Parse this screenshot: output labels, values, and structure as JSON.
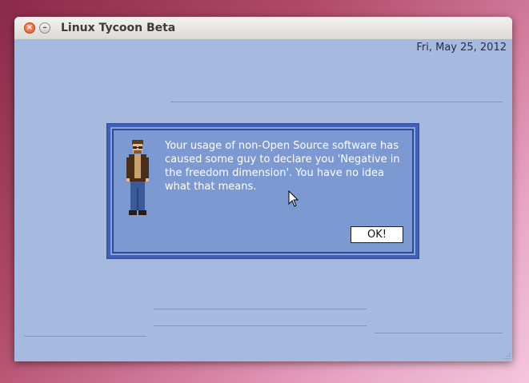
{
  "window": {
    "title": "Linux Tycoon Beta",
    "close_icon": "close-icon",
    "minimize_icon": "minimize-icon"
  },
  "status": {
    "date": "Fri, May 25, 2012"
  },
  "dialog": {
    "message": "Your usage of non-Open Source software has\ncaused some guy to declare you 'Negative in\nthe freedom dimension'.  You have no idea\nwhat that means.",
    "ok_label": "OK!",
    "character_icon": "pixel-character-icon"
  },
  "colors": {
    "window_bg": "#a6b9df",
    "dialog_bg": "#7c99d1",
    "dialog_border": "#3f60b4"
  }
}
